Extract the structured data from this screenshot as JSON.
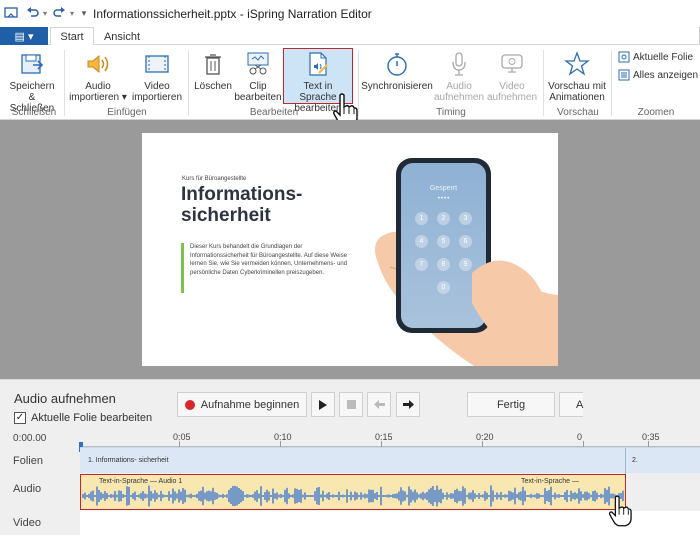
{
  "titlebar": {
    "title": "Informationssicherheit.pptx - iSpring Narration Editor"
  },
  "tabs": {
    "file_icon": "▤ ▾",
    "start": "Start",
    "ansicht": "Ansicht"
  },
  "ribbon": {
    "buttons": [
      {
        "label": "Speichern\n& Schließen",
        "line1": "Speichern",
        "line2": "& Schließen",
        "icon": "save-icon"
      },
      {
        "line1": "Audio",
        "line2": "importieren ▾",
        "icon": "speaker-icon"
      },
      {
        "line1": "Video",
        "line2": "importieren",
        "icon": "video-icon"
      },
      {
        "line1": "Löschen",
        "line2": "",
        "icon": "trash-icon"
      },
      {
        "line1": "Clip",
        "line2": "bearbeiten",
        "icon": "clip-icon"
      },
      {
        "line1": "Text in Sprache",
        "line2": "bearbeiten",
        "icon": "tts-icon"
      },
      {
        "line1": "Synchronisieren",
        "line2": "",
        "icon": "stopwatch-icon"
      },
      {
        "line1": "Audio",
        "line2": "aufnehmen",
        "icon": "microphone-icon"
      },
      {
        "line1": "Video",
        "line2": "aufnehmen",
        "icon": "webcam-icon"
      },
      {
        "line1": "Vorschau mit",
        "line2": "Animationen",
        "icon": "star-icon"
      }
    ],
    "groups": {
      "schliessen": "Schließen",
      "einfuegen": "Einfügen",
      "bearbeiten": "Bearbeiten",
      "timing": "Timing",
      "vorschau": "Vorschau",
      "zoomen": "Zoomen"
    },
    "zoom": {
      "aktuelle": "Aktuelle Folie",
      "alle": "Alles anzeigen"
    }
  },
  "slide": {
    "kurs": "Kurs für Büroangestellte",
    "title_line1": "Informations-",
    "title_line2": "sicherheit",
    "body": "Dieser Kurs behandelt die Grundlagen der Informationssicherheit für Büroangestellte. Auf diese Weise lernen Sie, wie Sie vermeiden können, Unternehmens- und persönliche Daten Cyberkriminellen preiszugeben.",
    "phone_status": "Gesperrt",
    "keys": [
      "1",
      "2",
      "3",
      "4",
      "5",
      "6",
      "7",
      "8",
      "9",
      "0"
    ]
  },
  "recording": {
    "title": "Audio aufnehmen",
    "checkbox_label": "Aktuelle Folie bearbeiten",
    "checkbox_checked": true,
    "start_button": "Aufnahme beginnen",
    "done_button": "Fertig",
    "cut_button": "A"
  },
  "timeline": {
    "current_time": "0:00.00",
    "ticks": [
      "0:05",
      "0:10",
      "0:15",
      "0:20",
      "0",
      "0:35"
    ],
    "rows": {
      "folien": "Folien",
      "audio": "Audio",
      "video": "Video"
    },
    "folie1": "1. Informations- sicherheit",
    "folie2": "2.",
    "audio_clip1": "Text-in-Sprache — Audio 1",
    "audio_clip2": "Text-in-Sprache —"
  },
  "colors": {
    "accent": "#1e5fa8",
    "highlight": "#c0272d",
    "audio_fill": "#f8e7b0",
    "wave": "#2f6fd1",
    "slide_green": "#7dc24b"
  }
}
